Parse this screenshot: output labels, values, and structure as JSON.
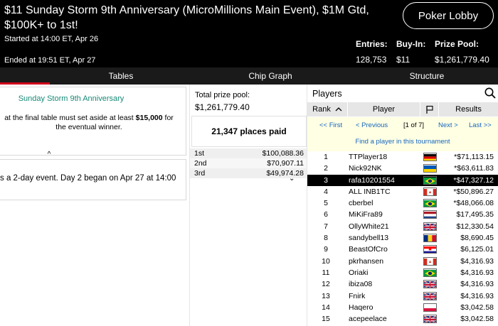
{
  "header": {
    "title": "$11 Sunday Storm 9th Anniversary (MicroMillions Main Event), $1M Gtd, $100K+ to 1st!",
    "started": "Started at 14:00 ET, Apr 26",
    "ended": "Ended at 19:51 ET, Apr 27",
    "lobby_button": "Poker Lobby",
    "stats": [
      {
        "label": "Entries:",
        "value": "128,753"
      },
      {
        "label": "Buy-In:",
        "value": "$11"
      },
      {
        "label": "Prize Pool:",
        "value": "$1,261,779.40"
      }
    ]
  },
  "tabs": [
    "Tables",
    "Chip Graph",
    "Structure"
  ],
  "left": {
    "card1_title": "Sunday Storm 9th Anniversary",
    "card1_text_a": "at the final table must set aside at least ",
    "card1_text_bold": "$15,000",
    "card1_text_b": " for the eventual winner.",
    "card1_toggle": "^",
    "card2_text": "s a 2-day event. Day 2 began on Apr 27 at 14:00"
  },
  "middle": {
    "total_label": "Total prize pool:",
    "total_value": "$1,261,779.40",
    "places_paid": "21,347 places paid",
    "payouts": [
      {
        "place": "1st",
        "amount": "$100,088.36"
      },
      {
        "place": "2nd",
        "amount": "$70,907.11"
      },
      {
        "place": "3rd",
        "amount": "$49,974.28"
      }
    ],
    "toggle": "⌄"
  },
  "players": {
    "title": "Players",
    "columns": [
      "Rank",
      "Player",
      "",
      "Results"
    ],
    "first": "<< First",
    "previous": "< Previous",
    "page": "[1 of 7]",
    "next": "Next >",
    "last": "Last >>",
    "find": "Find a player in this tournament",
    "rows": [
      {
        "rank": "1",
        "name": "TTPlayer18",
        "flag": "de",
        "result": "*$71,113.15"
      },
      {
        "rank": "2",
        "name": "Nick92NK",
        "flag": "ua",
        "result": "*$63,611.83"
      },
      {
        "rank": "3",
        "name": "rafa10201554",
        "flag": "br",
        "result": "*$47,327.12",
        "highlight": true
      },
      {
        "rank": "4",
        "name": "ALL INB1TC",
        "flag": "ca",
        "result": "*$50,896.27"
      },
      {
        "rank": "5",
        "name": "cberbel",
        "flag": "br",
        "result": "*$48,066.08"
      },
      {
        "rank": "6",
        "name": "MiKiFra89",
        "flag": "nl",
        "result": "$17,495.35"
      },
      {
        "rank": "7",
        "name": "OllyWhite21",
        "flag": "gb",
        "result": "$12,330.54"
      },
      {
        "rank": "8",
        "name": "sandybell13",
        "flag": "ro",
        "result": "$8,690.45"
      },
      {
        "rank": "9",
        "name": "BeastOfCro",
        "flag": "hr",
        "result": "$6,125.01"
      },
      {
        "rank": "10",
        "name": "pkrhansen",
        "flag": "ca",
        "result": "$4,316.93"
      },
      {
        "rank": "11",
        "name": "Oriaki",
        "flag": "br",
        "result": "$4,316.93"
      },
      {
        "rank": "12",
        "name": "ibiza08",
        "flag": "gb",
        "result": "$4,316.93"
      },
      {
        "rank": "13",
        "name": "Fnirk",
        "flag": "gb",
        "result": "$4,316.93"
      },
      {
        "rank": "14",
        "name": "Haqero",
        "flag": "pl",
        "result": "$3,042.58"
      },
      {
        "rank": "15",
        "name": "acepeelace",
        "flag": "gb",
        "result": "$3,042.58"
      }
    ]
  }
}
